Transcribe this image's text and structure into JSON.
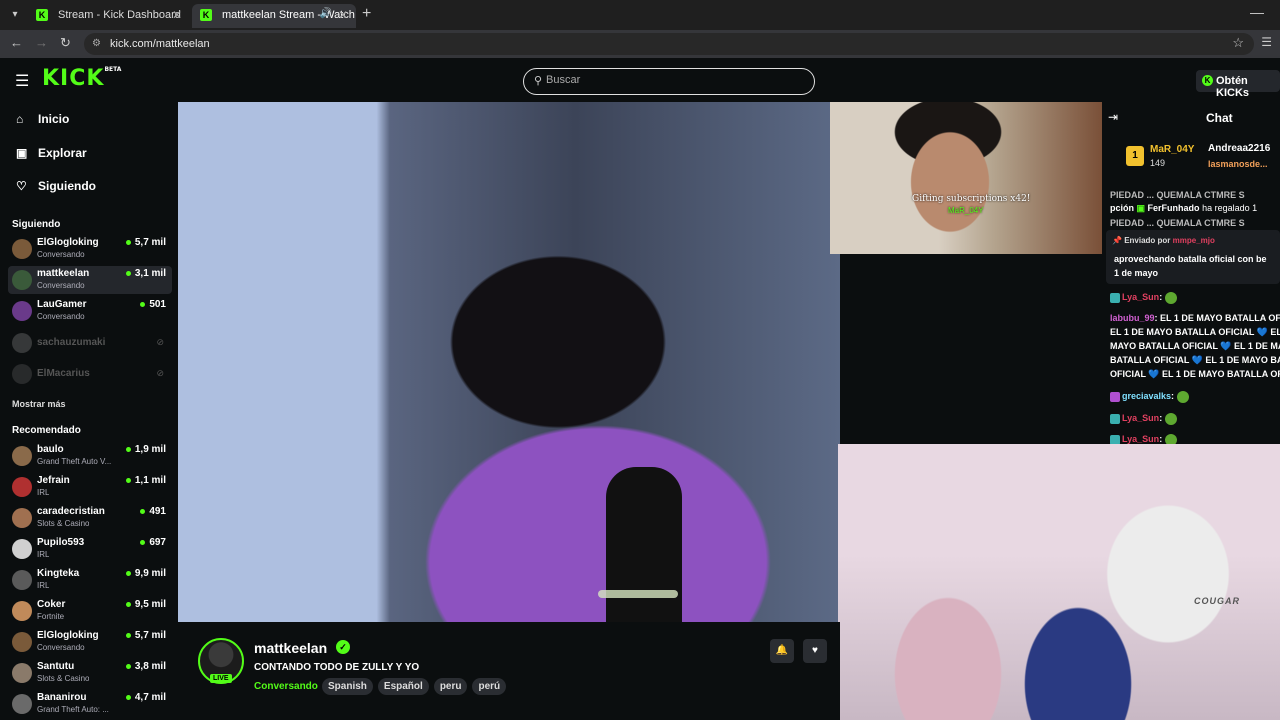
{
  "browser": {
    "tabs": [
      {
        "title": "Stream - Kick Dashboard"
      },
      {
        "title": "mattkeelan Stream - Watch"
      }
    ],
    "url": "kick.com/mattkeelan"
  },
  "header": {
    "logo": "KICK",
    "logo_sup": "BETA",
    "search_placeholder": "Buscar",
    "kicks_button": "Obtén KICKs"
  },
  "sidebar": {
    "nav": [
      {
        "label": "Inicio",
        "icon": "home-icon"
      },
      {
        "label": "Explorar",
        "icon": "compass-icon"
      },
      {
        "label": "Siguiendo",
        "icon": "heart-icon"
      }
    ],
    "following_title": "Siguiendo",
    "following": [
      {
        "name": "ElGlogloking",
        "category": "Conversando",
        "viewers": "5,7 mil",
        "color": "#7a5a3a"
      },
      {
        "name": "mattkeelan",
        "category": "Conversando",
        "viewers": "3,1 mil",
        "color": "#3a5a3a"
      },
      {
        "name": "LauGamer",
        "category": "Conversando",
        "viewers": "501",
        "color": "#6a3a8a"
      },
      {
        "name": "sachauzumaki",
        "color": "#777"
      },
      {
        "name": "ElMacarius",
        "color": "#555"
      }
    ],
    "show_more": "Mostrar más",
    "recommended_title": "Recomendado",
    "recommended": [
      {
        "name": "baulo",
        "category": "Grand Theft Auto V...",
        "viewers": "1,9 mil",
        "color": "#8a6a4a"
      },
      {
        "name": "Jefrain",
        "category": "IRL",
        "viewers": "1,1 mil",
        "color": "#b03030"
      },
      {
        "name": "caradecristian",
        "category": "Slots & Casino",
        "viewers": "491",
        "color": "#a07050"
      },
      {
        "name": "Pupilo593",
        "category": "IRL",
        "viewers": "697",
        "color": "#d0d0d0"
      },
      {
        "name": "Kingteka",
        "category": "IRL",
        "viewers": "9,9 mil",
        "color": "#5a5a5a"
      },
      {
        "name": "Coker",
        "category": "Fortnite",
        "viewers": "9,5 mil",
        "color": "#c08a5a"
      },
      {
        "name": "ElGlogloking",
        "category": "Conversando",
        "viewers": "5,7 mil",
        "color": "#7a5a3a"
      },
      {
        "name": "Santutu",
        "category": "Slots & Casino",
        "viewers": "3,8 mil",
        "color": "#8a7a6a"
      },
      {
        "name": "Bananirou",
        "category": "Grand Theft Auto: ...",
        "viewers": "4,7 mil",
        "color": "#6a6a6a"
      }
    ]
  },
  "overlay": {
    "gift_text": "Gifting subscriptions x42!",
    "gift_user": "MaR_04Y",
    "chair_brand": "COUGAR"
  },
  "channel": {
    "name": "mattkeelan",
    "live_badge": "LIVE",
    "title": "CONTANDO TODO DE ZULLY Y YO",
    "category": "Conversando",
    "tags": [
      "Spanish",
      "Español",
      "peru",
      "perú"
    ]
  },
  "chat": {
    "title": "Chat",
    "leader": {
      "rank": "1",
      "user": "MaR_04Y",
      "points": "149"
    },
    "leader2": "Andreaa2216",
    "leader3": "lasmanosde...",
    "banner_line1": "PIEDAD ... QUEMALA CTMRE S",
    "gift_line_prefix": "pción",
    "gift_user": "FerFunhado",
    "gift_line_suffix": "ha regalado 1",
    "banner_line2": "PIEDAD ... QUEMALA CTMRE S",
    "pinned_by_label": "Enviado por",
    "pinned_by_user": "mmpe_mjo",
    "pinned_text1": "aprovechando batalla oficial con be",
    "pinned_text2": "1 de mayo",
    "messages": [
      {
        "user": "Lya_Sun",
        "text": ""
      },
      {
        "user": "labubu_99",
        "text": "EL 1 DE MAYO BATALLA OFI"
      },
      {
        "user": "",
        "text": "EL 1 DE MAYO BATALLA OFICIAL 💙 EL 1 DE"
      },
      {
        "user": "",
        "text": "MAYO BATALLA OFICIAL 💙 EL 1 DE MAYO"
      },
      {
        "user": "",
        "text": "BATALLA OFICIAL 💙 EL 1 DE MAYO BATALLA"
      },
      {
        "user": "",
        "text": "OFICIAL 💙 EL 1 DE MAYO BATALLA OFICIAL"
      },
      {
        "user": "greciavalks",
        "text": ""
      },
      {
        "user": "Lya_Sun",
        "text": ""
      },
      {
        "user": "Lya_Sun",
        "text": ""
      }
    ]
  }
}
